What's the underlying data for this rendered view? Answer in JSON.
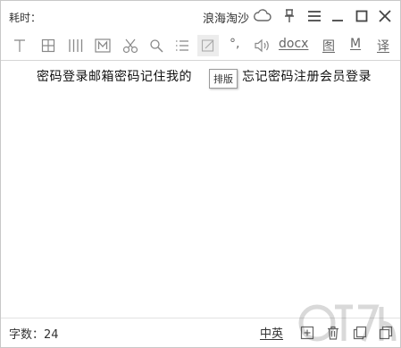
{
  "titlebar": {
    "time_label": "耗时：",
    "brand": "浪海淘沙"
  },
  "toolbar": {
    "icons": [
      "text-icon",
      "table-icon",
      "columns-icon",
      "m-box-icon",
      "scissors-icon",
      "search-icon",
      "list-icon",
      "layout-icon",
      "degree-icon",
      "speaker-icon"
    ],
    "degree_label": "°,",
    "docx_label": "docx",
    "image_label": "图",
    "m_label": "M",
    "translate_label": "译"
  },
  "content": {
    "text": "密码登录邮箱密码记住我的",
    "text_tail": "忘记密码注册会员登录"
  },
  "tooltip": {
    "text": "排版"
  },
  "statusbar": {
    "count_label": "字数：24",
    "lang_label": "中英"
  },
  "colors": {
    "icon": "#666666",
    "active_bg": "#ececec",
    "separator": "#d6d6d6"
  }
}
